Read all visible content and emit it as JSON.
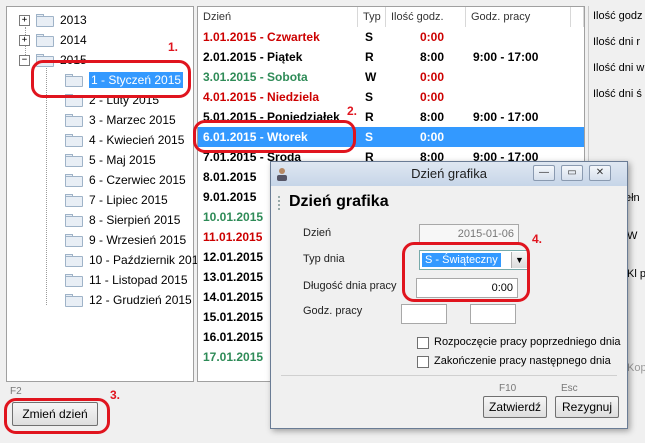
{
  "tree": {
    "years": [
      {
        "label": "2013",
        "expander": "+"
      },
      {
        "label": "2014",
        "expander": "+"
      },
      {
        "label": "2015",
        "expander": "−"
      }
    ],
    "months": [
      {
        "label": "1 - Styczeń 2015"
      },
      {
        "label": "2 - Luty 2015"
      },
      {
        "label": "3 - Marzec 2015"
      },
      {
        "label": "4 - Kwiecień 2015"
      },
      {
        "label": "5 - Maj 2015"
      },
      {
        "label": "6 - Czerwiec 2015"
      },
      {
        "label": "7 - Lipiec 2015"
      },
      {
        "label": "8 - Sierpień 2015"
      },
      {
        "label": "9 - Wrzesień 2015"
      },
      {
        "label": "10 - Październik 2015"
      },
      {
        "label": "11 - Listopad 2015"
      },
      {
        "label": "12 - Grudzień 2015"
      }
    ],
    "selected_month_index": 0
  },
  "grid": {
    "headers": [
      "Dzień",
      "Typ",
      "Ilość godz.",
      "Godz. pracy"
    ],
    "rows": [
      {
        "day": "1.01.2015 - Czwartek",
        "typ": "S",
        "hours": "0:00",
        "work": "",
        "color": "#cc0000"
      },
      {
        "day": "2.01.2015 - Piątek",
        "typ": "R",
        "hours": "8:00",
        "work": "9:00 - 17:00",
        "color": "#000000"
      },
      {
        "day": "3.01.2015 - Sobota",
        "typ": "W",
        "hours": "0:00",
        "work": "",
        "color": "#2e8b57"
      },
      {
        "day": "4.01.2015 - Niedziela",
        "typ": "S",
        "hours": "0:00",
        "work": "",
        "color": "#cc0000"
      },
      {
        "day": "5.01.2015 - Poniedziałek",
        "typ": "R",
        "hours": "8:00",
        "work": "9:00 - 17:00",
        "color": "#000000"
      },
      {
        "day": "6.01.2015 - Wtorek",
        "typ": "S",
        "hours": "0:00",
        "work": "",
        "color": "#000000"
      },
      {
        "day": "7.01.2015 - Środa",
        "typ": "R",
        "hours": "8:00",
        "work": "9:00 - 17:00",
        "color": "#000000"
      },
      {
        "day": "8.01.2015",
        "typ": "",
        "hours": "",
        "work": "",
        "color": "#000000"
      },
      {
        "day": "9.01.2015",
        "typ": "",
        "hours": "",
        "work": "",
        "color": "#000000"
      },
      {
        "day": "10.01.2015",
        "typ": "",
        "hours": "",
        "work": "",
        "color": "#2e8b57"
      },
      {
        "day": "11.01.2015",
        "typ": "",
        "hours": "",
        "work": "",
        "color": "#cc0000"
      },
      {
        "day": "12.01.2015",
        "typ": "",
        "hours": "",
        "work": "",
        "color": "#000000"
      },
      {
        "day": "13.01.2015",
        "typ": "",
        "hours": "",
        "work": "",
        "color": "#000000"
      },
      {
        "day": "14.01.2015",
        "typ": "",
        "hours": "",
        "work": "",
        "color": "#000000"
      },
      {
        "day": "15.01.2015",
        "typ": "",
        "hours": "",
        "work": "",
        "color": "#000000"
      },
      {
        "day": "16.01.2015",
        "typ": "",
        "hours": "",
        "work": "",
        "color": "#000000"
      },
      {
        "day": "17.01.2015",
        "typ": "",
        "hours": "",
        "work": "",
        "color": "#2e8b57"
      }
    ],
    "selected_row_index": 5,
    "zero_hours_color": "#cc0000",
    "selection_color": "#3399ff"
  },
  "right_panel": {
    "labels": [
      "Ilość godz",
      "Ilość dni r",
      "Ilość dni w",
      "Ilość dni ś",
      "ełn",
      "W",
      "Kl p",
      "Kop"
    ]
  },
  "bottom": {
    "fkey_hint": "F2",
    "change_day_button": "Zmień dzień"
  },
  "dialog": {
    "title": "Dzień grafika",
    "heading": "Dzień grafika",
    "fields": {
      "day_label": "Dzień",
      "day_value": "2015-01-06",
      "type_label": "Typ dnia",
      "type_value": "S - Świąteczny",
      "length_label": "Długość dnia pracy",
      "length_value": "0:00",
      "hours_label": "Godz. pracy"
    },
    "checkboxes": [
      {
        "label": "Rozpoczęcie pracy poprzedniego dnia",
        "checked": false
      },
      {
        "label": "Zakończenie pracy następnego dnia",
        "checked": false
      }
    ],
    "buttons": {
      "confirm_hint": "F10",
      "confirm": "Zatwierdź",
      "cancel_hint": "Esc",
      "cancel": "Rezygnuj"
    }
  },
  "annotations": [
    "1.",
    "2.",
    "3.",
    "4."
  ],
  "annotation_color": "#e0141e"
}
